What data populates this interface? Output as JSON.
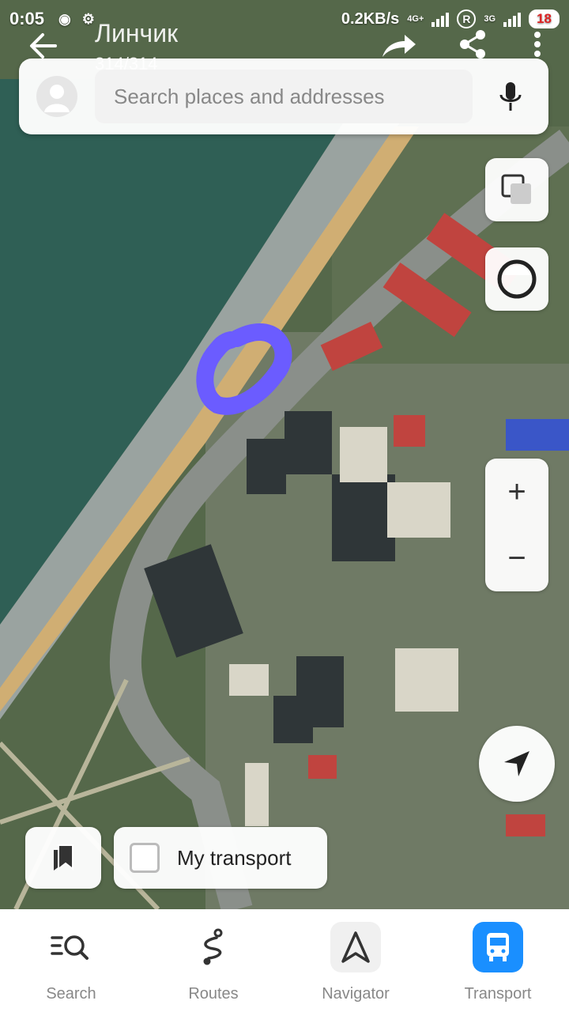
{
  "status_bar": {
    "time": "0:05",
    "net_speed": "0.2KB/s",
    "net_type_1": "4G+",
    "net_type_2": "3G",
    "roaming": "R",
    "battery": "18"
  },
  "gallery": {
    "title": "Линчик",
    "counter": "314/314"
  },
  "search": {
    "placeholder": "Search places and addresses"
  },
  "controls": {
    "zoom_in": "+",
    "zoom_out": "−"
  },
  "my_transport": {
    "label": "My transport",
    "checked": false
  },
  "bottom_nav": {
    "items": [
      {
        "label": "Search",
        "icon": "search-list-icon",
        "active": false
      },
      {
        "label": "Routes",
        "icon": "routes-icon",
        "active": false
      },
      {
        "label": "Navigator",
        "icon": "navigator-icon",
        "active": false
      },
      {
        "label": "Transport",
        "icon": "bus-icon",
        "active": true
      }
    ]
  },
  "colors": {
    "accent": "#1a8fff",
    "annotation": "#6b5cff",
    "sea": "#2f5f55",
    "beach": "#9aa3a0",
    "road": "#8a8f8a"
  }
}
